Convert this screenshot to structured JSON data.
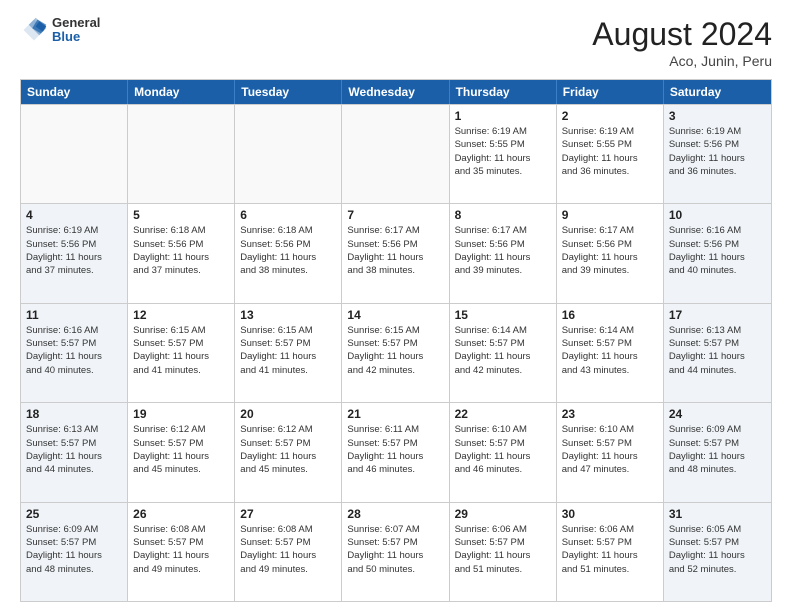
{
  "header": {
    "logo": {
      "general": "General",
      "blue": "Blue"
    },
    "title": "August 2024",
    "location": "Aco, Junin, Peru"
  },
  "days_of_week": [
    "Sunday",
    "Monday",
    "Tuesday",
    "Wednesday",
    "Thursday",
    "Friday",
    "Saturday"
  ],
  "weeks": [
    {
      "cells": [
        {
          "day": "",
          "lines": [],
          "empty": true
        },
        {
          "day": "",
          "lines": [],
          "empty": true
        },
        {
          "day": "",
          "lines": [],
          "empty": true
        },
        {
          "day": "",
          "lines": [],
          "empty": true
        },
        {
          "day": "1",
          "lines": [
            "Sunrise: 6:19 AM",
            "Sunset: 5:55 PM",
            "Daylight: 11 hours",
            "and 35 minutes."
          ],
          "empty": false
        },
        {
          "day": "2",
          "lines": [
            "Sunrise: 6:19 AM",
            "Sunset: 5:55 PM",
            "Daylight: 11 hours",
            "and 36 minutes."
          ],
          "empty": false
        },
        {
          "day": "3",
          "lines": [
            "Sunrise: 6:19 AM",
            "Sunset: 5:56 PM",
            "Daylight: 11 hours",
            "and 36 minutes."
          ],
          "empty": false
        }
      ]
    },
    {
      "cells": [
        {
          "day": "4",
          "lines": [
            "Sunrise: 6:19 AM",
            "Sunset: 5:56 PM",
            "Daylight: 11 hours",
            "and 37 minutes."
          ],
          "empty": false
        },
        {
          "day": "5",
          "lines": [
            "Sunrise: 6:18 AM",
            "Sunset: 5:56 PM",
            "Daylight: 11 hours",
            "and 37 minutes."
          ],
          "empty": false
        },
        {
          "day": "6",
          "lines": [
            "Sunrise: 6:18 AM",
            "Sunset: 5:56 PM",
            "Daylight: 11 hours",
            "and 38 minutes."
          ],
          "empty": false
        },
        {
          "day": "7",
          "lines": [
            "Sunrise: 6:17 AM",
            "Sunset: 5:56 PM",
            "Daylight: 11 hours",
            "and 38 minutes."
          ],
          "empty": false
        },
        {
          "day": "8",
          "lines": [
            "Sunrise: 6:17 AM",
            "Sunset: 5:56 PM",
            "Daylight: 11 hours",
            "and 39 minutes."
          ],
          "empty": false
        },
        {
          "day": "9",
          "lines": [
            "Sunrise: 6:17 AM",
            "Sunset: 5:56 PM",
            "Daylight: 11 hours",
            "and 39 minutes."
          ],
          "empty": false
        },
        {
          "day": "10",
          "lines": [
            "Sunrise: 6:16 AM",
            "Sunset: 5:56 PM",
            "Daylight: 11 hours",
            "and 40 minutes."
          ],
          "empty": false
        }
      ]
    },
    {
      "cells": [
        {
          "day": "11",
          "lines": [
            "Sunrise: 6:16 AM",
            "Sunset: 5:57 PM",
            "Daylight: 11 hours",
            "and 40 minutes."
          ],
          "empty": false
        },
        {
          "day": "12",
          "lines": [
            "Sunrise: 6:15 AM",
            "Sunset: 5:57 PM",
            "Daylight: 11 hours",
            "and 41 minutes."
          ],
          "empty": false
        },
        {
          "day": "13",
          "lines": [
            "Sunrise: 6:15 AM",
            "Sunset: 5:57 PM",
            "Daylight: 11 hours",
            "and 41 minutes."
          ],
          "empty": false
        },
        {
          "day": "14",
          "lines": [
            "Sunrise: 6:15 AM",
            "Sunset: 5:57 PM",
            "Daylight: 11 hours",
            "and 42 minutes."
          ],
          "empty": false
        },
        {
          "day": "15",
          "lines": [
            "Sunrise: 6:14 AM",
            "Sunset: 5:57 PM",
            "Daylight: 11 hours",
            "and 42 minutes."
          ],
          "empty": false
        },
        {
          "day": "16",
          "lines": [
            "Sunrise: 6:14 AM",
            "Sunset: 5:57 PM",
            "Daylight: 11 hours",
            "and 43 minutes."
          ],
          "empty": false
        },
        {
          "day": "17",
          "lines": [
            "Sunrise: 6:13 AM",
            "Sunset: 5:57 PM",
            "Daylight: 11 hours",
            "and 44 minutes."
          ],
          "empty": false
        }
      ]
    },
    {
      "cells": [
        {
          "day": "18",
          "lines": [
            "Sunrise: 6:13 AM",
            "Sunset: 5:57 PM",
            "Daylight: 11 hours",
            "and 44 minutes."
          ],
          "empty": false
        },
        {
          "day": "19",
          "lines": [
            "Sunrise: 6:12 AM",
            "Sunset: 5:57 PM",
            "Daylight: 11 hours",
            "and 45 minutes."
          ],
          "empty": false
        },
        {
          "day": "20",
          "lines": [
            "Sunrise: 6:12 AM",
            "Sunset: 5:57 PM",
            "Daylight: 11 hours",
            "and 45 minutes."
          ],
          "empty": false
        },
        {
          "day": "21",
          "lines": [
            "Sunrise: 6:11 AM",
            "Sunset: 5:57 PM",
            "Daylight: 11 hours",
            "and 46 minutes."
          ],
          "empty": false
        },
        {
          "day": "22",
          "lines": [
            "Sunrise: 6:10 AM",
            "Sunset: 5:57 PM",
            "Daylight: 11 hours",
            "and 46 minutes."
          ],
          "empty": false
        },
        {
          "day": "23",
          "lines": [
            "Sunrise: 6:10 AM",
            "Sunset: 5:57 PM",
            "Daylight: 11 hours",
            "and 47 minutes."
          ],
          "empty": false
        },
        {
          "day": "24",
          "lines": [
            "Sunrise: 6:09 AM",
            "Sunset: 5:57 PM",
            "Daylight: 11 hours",
            "and 48 minutes."
          ],
          "empty": false
        }
      ]
    },
    {
      "cells": [
        {
          "day": "25",
          "lines": [
            "Sunrise: 6:09 AM",
            "Sunset: 5:57 PM",
            "Daylight: 11 hours",
            "and 48 minutes."
          ],
          "empty": false
        },
        {
          "day": "26",
          "lines": [
            "Sunrise: 6:08 AM",
            "Sunset: 5:57 PM",
            "Daylight: 11 hours",
            "and 49 minutes."
          ],
          "empty": false
        },
        {
          "day": "27",
          "lines": [
            "Sunrise: 6:08 AM",
            "Sunset: 5:57 PM",
            "Daylight: 11 hours",
            "and 49 minutes."
          ],
          "empty": false
        },
        {
          "day": "28",
          "lines": [
            "Sunrise: 6:07 AM",
            "Sunset: 5:57 PM",
            "Daylight: 11 hours",
            "and 50 minutes."
          ],
          "empty": false
        },
        {
          "day": "29",
          "lines": [
            "Sunrise: 6:06 AM",
            "Sunset: 5:57 PM",
            "Daylight: 11 hours",
            "and 51 minutes."
          ],
          "empty": false
        },
        {
          "day": "30",
          "lines": [
            "Sunrise: 6:06 AM",
            "Sunset: 5:57 PM",
            "Daylight: 11 hours",
            "and 51 minutes."
          ],
          "empty": false
        },
        {
          "day": "31",
          "lines": [
            "Sunrise: 6:05 AM",
            "Sunset: 5:57 PM",
            "Daylight: 11 hours",
            "and 52 minutes."
          ],
          "empty": false
        }
      ]
    }
  ]
}
